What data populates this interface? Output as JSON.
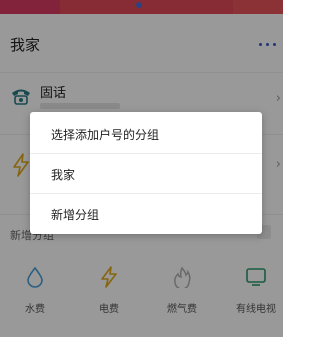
{
  "colors": {
    "banner": "#e24a57",
    "accent_blue": "#3a58c8",
    "phone_icon": "#2a7c86",
    "electric_icon": "#e0a818",
    "water_icon": "#4a9ed8",
    "gas_icon": "#b0b0b0",
    "cable_icon": "#2a9a6a"
  },
  "header": {
    "title": "我家",
    "menu_icon": "more-dots-icon"
  },
  "accounts": [
    {
      "name": "固话",
      "icon": "phone-icon"
    },
    {
      "name": "",
      "icon": "bolt-icon"
    }
  ],
  "add_group": {
    "label": "新增分组"
  },
  "services": [
    {
      "label": "水费",
      "icon": "water-drop-icon"
    },
    {
      "label": "电费",
      "icon": "bolt-icon"
    },
    {
      "label": "燃气费",
      "icon": "flame-icon"
    },
    {
      "label": "有线电视",
      "icon": "tv-icon"
    }
  ],
  "dialog": {
    "title": "选择添加户号的分组",
    "options": [
      "我家",
      "新增分组"
    ]
  }
}
